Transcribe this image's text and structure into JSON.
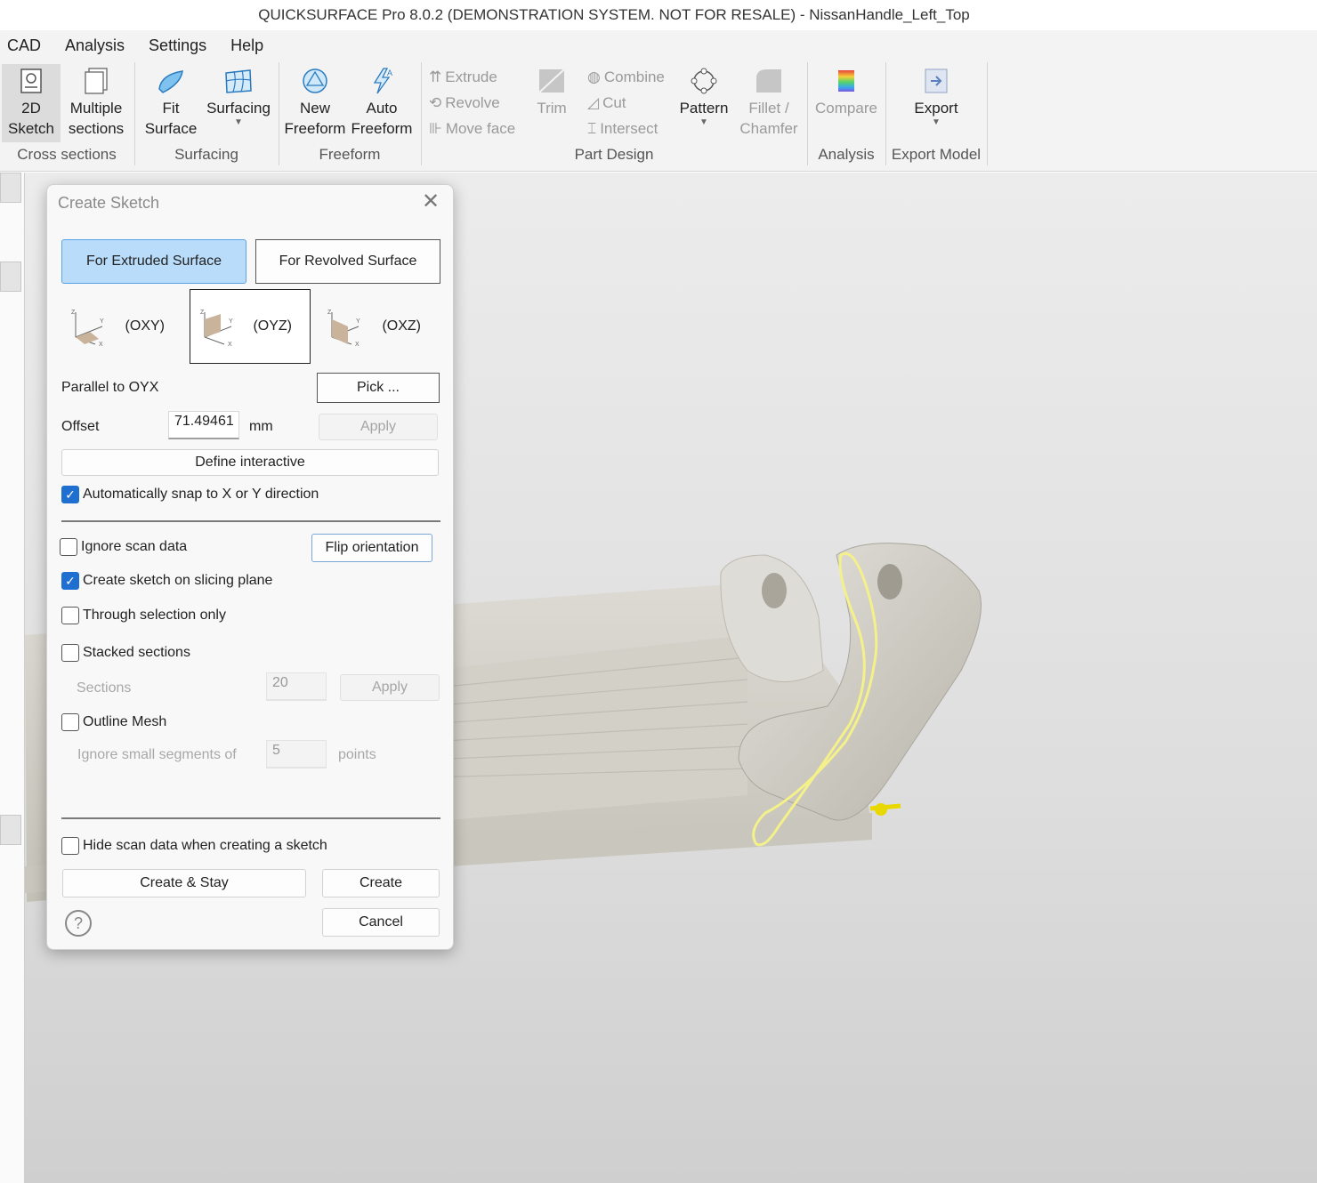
{
  "title": "QUICKSURFACE Pro 8.0.2 (DEMONSTRATION SYSTEM. NOT FOR RESALE) - NissanHandle_Left_Top",
  "menu": [
    "CAD",
    "Analysis",
    "Settings",
    "Help"
  ],
  "ribbon": {
    "cross_sections": {
      "label": "Cross sections",
      "sketch_2d": [
        "2D",
        "Sketch"
      ],
      "multiple_sections": [
        "Multiple",
        "sections"
      ]
    },
    "surfacing": {
      "label": "Surfacing",
      "fit_surface": [
        "Fit",
        "Surface"
      ],
      "surfacing": "Surfacing"
    },
    "freeform": {
      "label": "Freeform",
      "new_freeform": [
        "New",
        "Freeform"
      ],
      "auto_freeform": [
        "Auto",
        "Freeform"
      ]
    },
    "part_design": {
      "label": "Part Design",
      "extrude": "Extrude",
      "revolve": "Revolve",
      "move_face": "Move face",
      "trim": "Trim",
      "combine": "Combine",
      "cut": "Cut",
      "intersect": "Intersect",
      "pattern": "Pattern",
      "fillet": [
        "Fillet /",
        "Chamfer"
      ]
    },
    "analysis": {
      "label": "Analysis",
      "compare": "Compare"
    },
    "export_model": {
      "label": "Export Model",
      "export": "Export"
    }
  },
  "dialog": {
    "title": "Create Sketch",
    "close_glyph": "✕",
    "for_extruded": "For Extruded Surface",
    "for_revolved": "For Revolved Surface",
    "planes": [
      "(OXY)",
      "(OYZ)",
      "(OXZ)"
    ],
    "selected_plane": "(OYZ)",
    "parallel_label": "Parallel to OYX",
    "pick": "Pick ...",
    "offset_label": "Offset",
    "offset_value": "71.49461",
    "offset_unit": "mm",
    "apply": "Apply",
    "define_interactive": "Define interactive",
    "auto_snap": "Automatically snap to X or Y direction",
    "ignore_scan": "Ignore scan data",
    "flip_orientation": "Flip orientation",
    "create_on_slicing": "Create sketch on slicing plane",
    "through_selection": "Through selection only",
    "stacked_sections": "Stacked sections",
    "sections_label": "Sections",
    "sections_value": "20",
    "outline_mesh": "Outline Mesh",
    "ignore_small": "Ignore small segments of",
    "small_value": "5",
    "points": "points",
    "hide_scan": "Hide scan data when creating a sketch",
    "create_stay": "Create & Stay",
    "create": "Create",
    "cancel": "Cancel",
    "help": "?",
    "checkboxes": {
      "auto_snap": true,
      "ignore_scan": false,
      "create_on_slicing": true,
      "through_selection": false,
      "stacked_sections": false,
      "outline_mesh": false,
      "hide_scan": false
    }
  }
}
